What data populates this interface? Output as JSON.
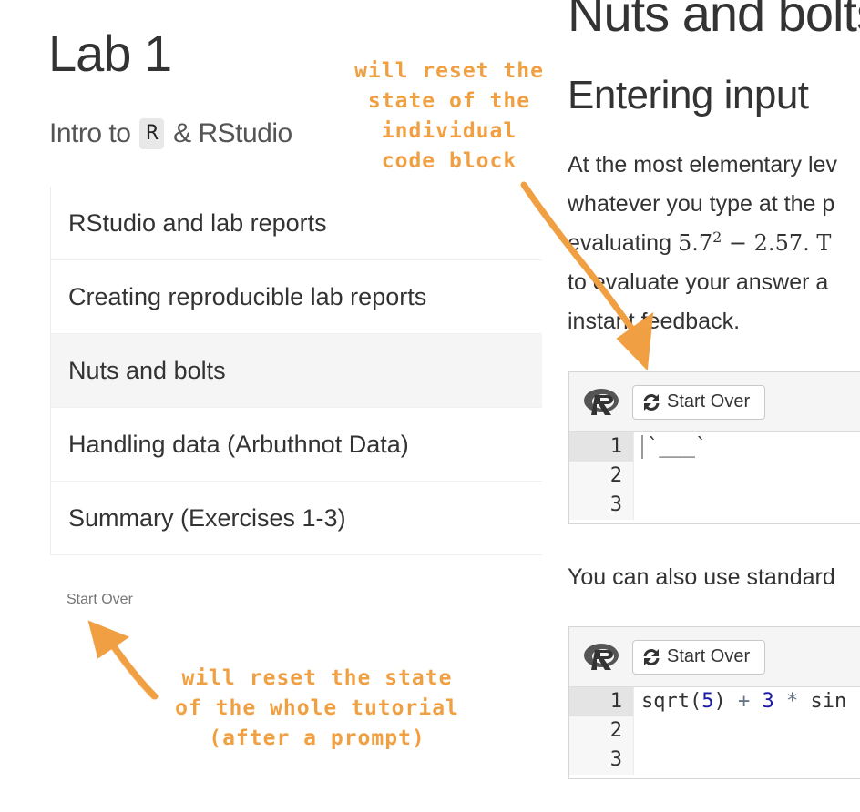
{
  "sidebar": {
    "title": "Lab 1",
    "subtitle_prefix": "Intro to",
    "subtitle_code": "R",
    "subtitle_suffix": "& RStudio",
    "items": [
      {
        "label": "RStudio and lab reports"
      },
      {
        "label": "Creating reproducible lab reports"
      },
      {
        "label": "Nuts and bolts"
      },
      {
        "label": "Handling data (Arbuthnot Data)"
      },
      {
        "label": "Summary (Exercises 1-3)"
      }
    ],
    "start_over": "Start Over"
  },
  "annotations": {
    "block_reset_lines": [
      "will reset the",
      "state of the",
      "individual",
      "code block"
    ],
    "tutorial_reset_lines": [
      "will reset the state",
      "of the whole tutorial",
      "(after a prompt)"
    ],
    "color": "#f0a042"
  },
  "main": {
    "section_title": "Nuts and bolts",
    "subsection_title": "Entering input",
    "paragraph_lines": [
      "At the most elementary lev",
      "whatever you type at the p",
      "evaluating ",
      "to evaluate your answer a",
      "instant feedback."
    ],
    "math_base": "5.7",
    "math_exp": "2",
    "math_rest": " − 2.57. T",
    "paragraph2": "You can also use standard",
    "code_blocks": [
      {
        "start_over": "Start Over",
        "line_numbers": [
          "1",
          "2",
          "3"
        ],
        "line1": "`___`"
      },
      {
        "start_over": "Start Over",
        "line_numbers": [
          "1",
          "2",
          "3"
        ],
        "tokens": {
          "fn": "sqrt(",
          "n1": "5",
          "close": ")",
          "plus": " + ",
          "n2": "3",
          "star": " * ",
          "rest": "sin"
        }
      }
    ],
    "icons": [
      "r-logo-icon",
      "refresh-icon"
    ]
  }
}
